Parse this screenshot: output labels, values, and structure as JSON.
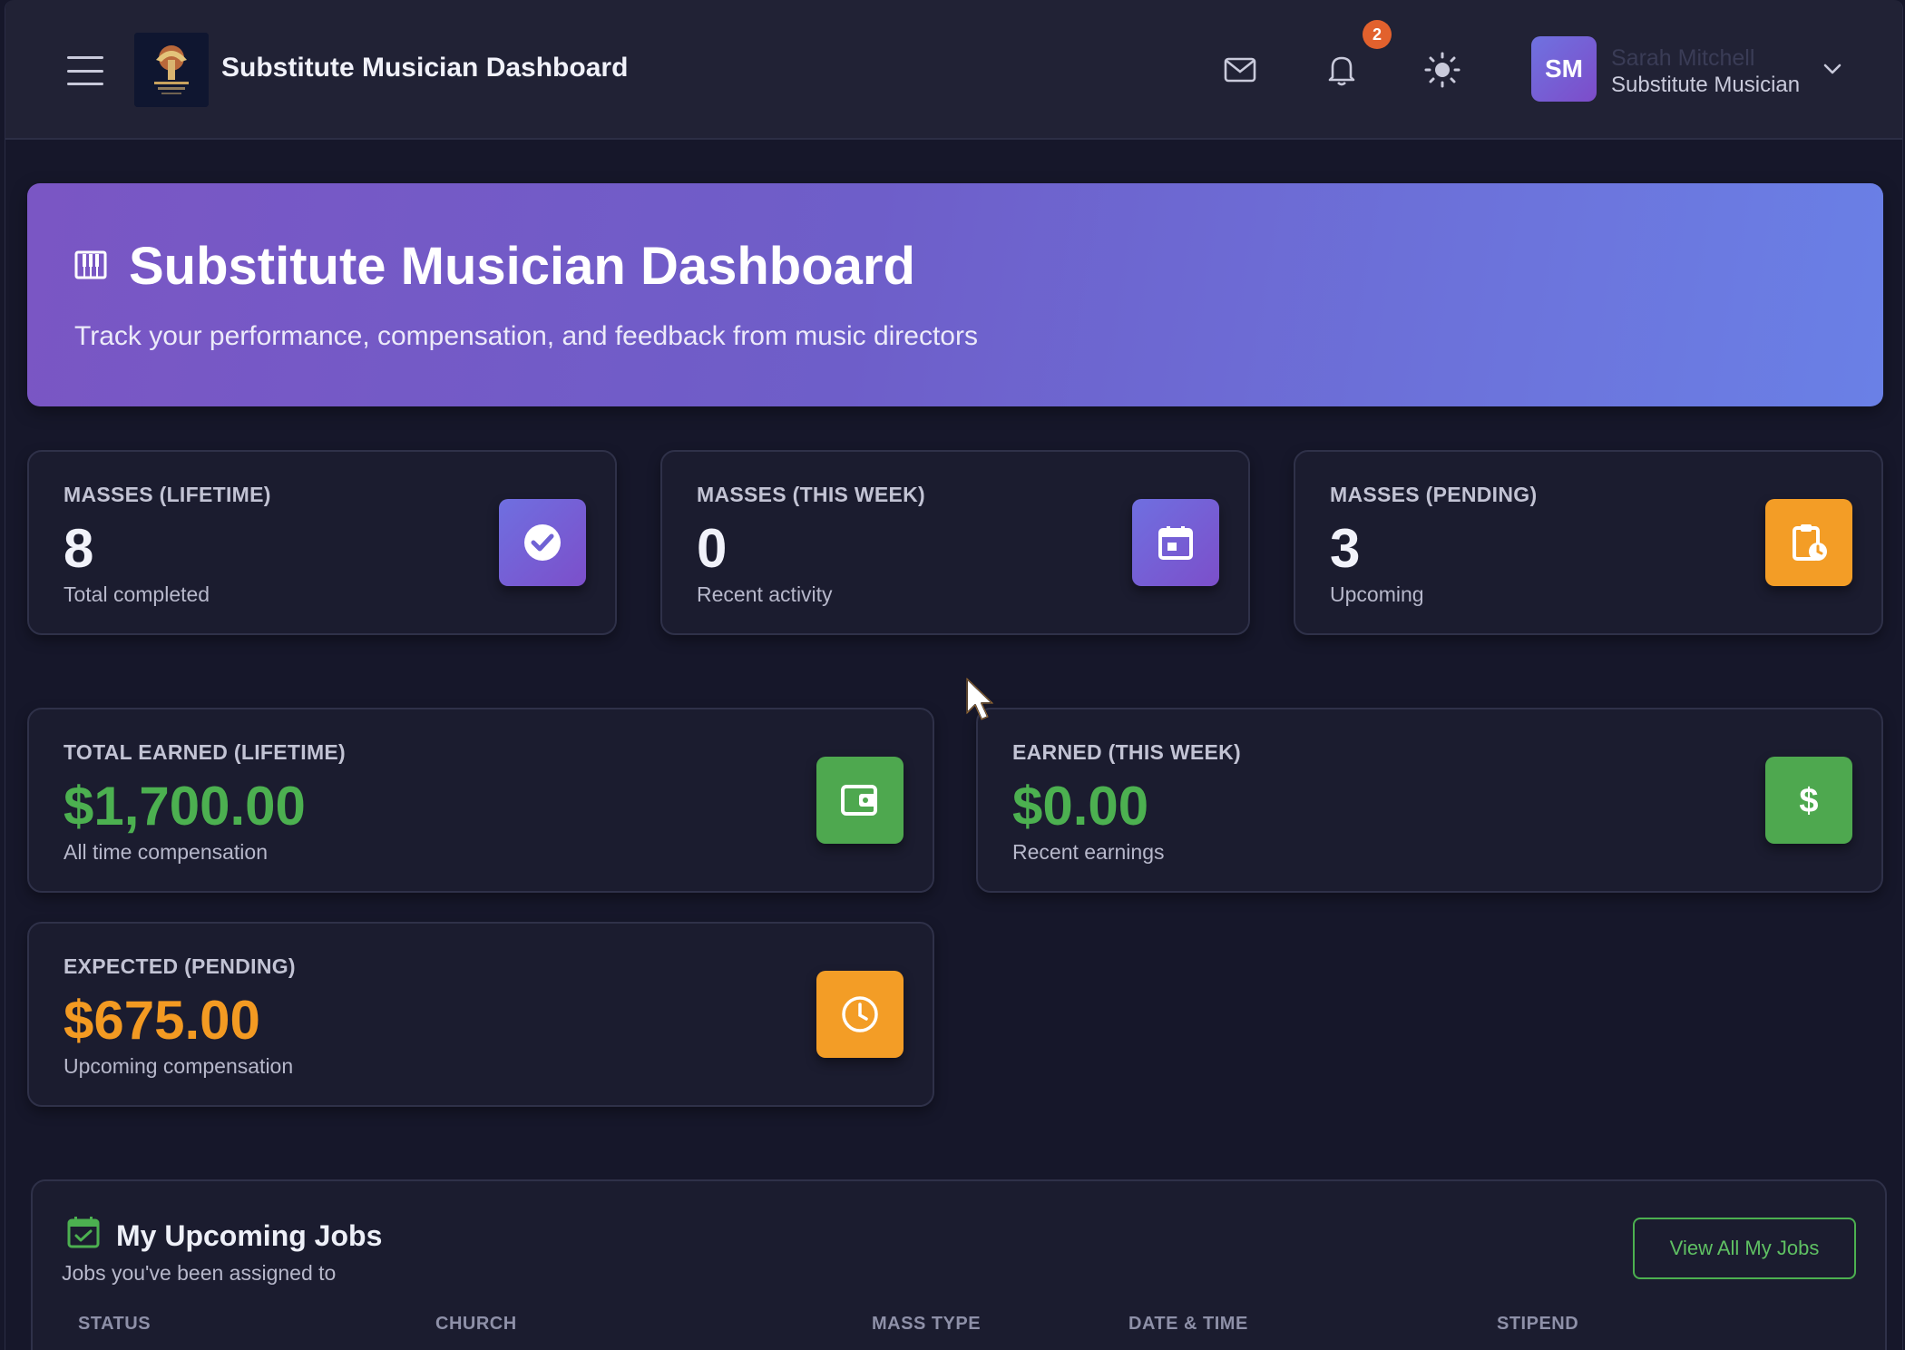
{
  "header": {
    "title": "Substitute Musician Dashboard",
    "notifications_count": "2",
    "user": {
      "initials": "SM",
      "name": "Sarah Mitchell",
      "role": "Substitute Musician"
    },
    "icons": [
      "menu-icon",
      "mail-icon",
      "bell-icon",
      "sun-icon",
      "chevron-down-icon"
    ]
  },
  "hero": {
    "title": "Substitute Musician Dashboard",
    "subtitle": "Track your performance, compensation, and feedback from music directors"
  },
  "stats": {
    "masses_lifetime": {
      "label": "MASSES (LIFETIME)",
      "value": "8",
      "sub": "Total completed",
      "icon": "check-circle-icon",
      "color": "#7268d8"
    },
    "masses_week": {
      "label": "MASSES (THIS WEEK)",
      "value": "0",
      "sub": "Recent activity",
      "icon": "calendar-icon",
      "color": "#7268d8"
    },
    "masses_pending": {
      "label": "MASSES (PENDING)",
      "value": "3",
      "sub": "Upcoming",
      "icon": "clipboard-clock-icon",
      "color": "#f39d26"
    },
    "earned_lifetime": {
      "label": "TOTAL EARNED (LIFETIME)",
      "value": "$1,700.00",
      "sub": "All time compensation",
      "icon": "wallet-icon",
      "color": "#4ea84f"
    },
    "earned_week": {
      "label": "EARNED (THIS WEEK)",
      "value": "$0.00",
      "sub": "Recent earnings",
      "icon": "dollar-icon",
      "color": "#4ea84f"
    },
    "expected_pending": {
      "label": "EXPECTED (PENDING)",
      "value": "$675.00",
      "sub": "Upcoming compensation",
      "icon": "clock-icon",
      "color": "#f39d26"
    }
  },
  "jobs": {
    "title": "My Upcoming Jobs",
    "subtitle": "Jobs you've been assigned to",
    "view_all": "View All My Jobs",
    "columns": [
      "STATUS",
      "CHURCH",
      "MASS TYPE",
      "DATE & TIME",
      "STIPEND"
    ]
  }
}
